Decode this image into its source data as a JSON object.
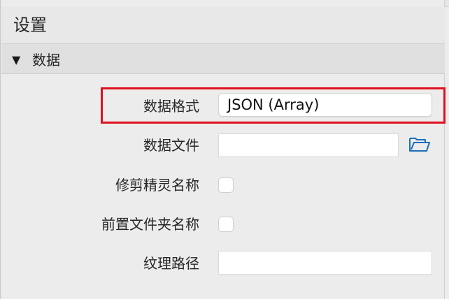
{
  "header": {
    "title": "设置"
  },
  "section": {
    "title": "数据",
    "toggle_glyph": "▼"
  },
  "fields": {
    "data_format": {
      "label": "数据格式",
      "value": "JSON (Array)"
    },
    "data_file": {
      "label": "数据文件",
      "value": "",
      "icon": "folder-icon"
    },
    "trim_sprite_names": {
      "label": "修剪精灵名称",
      "checked": false
    },
    "prepend_folder_name": {
      "label": "前置文件夹名称",
      "checked": false
    },
    "texture_path": {
      "label": "纹理路径",
      "value": ""
    }
  },
  "colors": {
    "highlight": "#e0101e",
    "folder_icon": "#1a6fb8"
  }
}
